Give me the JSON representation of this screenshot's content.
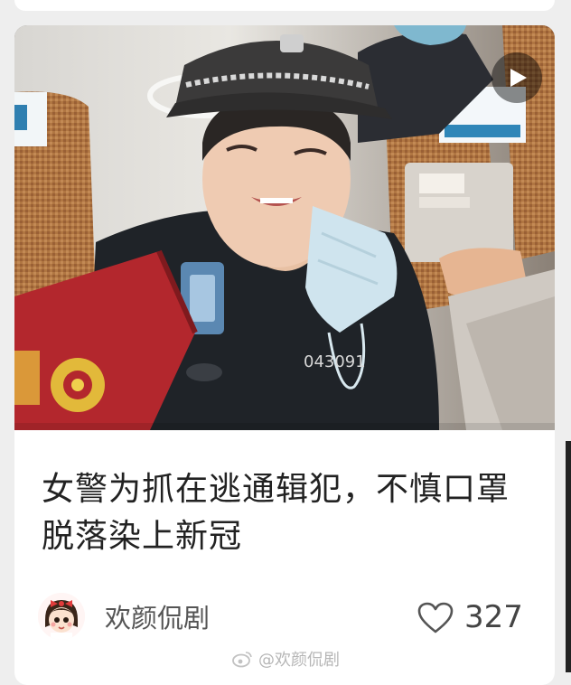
{
  "post": {
    "title": "女警为抓在逃通辑犯，不慎口罩脱落染上新冠",
    "badge_text": "043091",
    "author": "欢颜侃剧",
    "likes": "327"
  },
  "watermark": {
    "text": "@欢颜侃剧"
  },
  "icons": {
    "play": "play-icon",
    "like": "heart-outline-icon",
    "avatar": "cartoon-girl-avatar",
    "watermark": "weibo-logo-icon"
  },
  "colors": {
    "title": "#222222",
    "author": "#555555",
    "likes": "#444444",
    "card": "#ffffff",
    "background": "#eeeeee"
  }
}
